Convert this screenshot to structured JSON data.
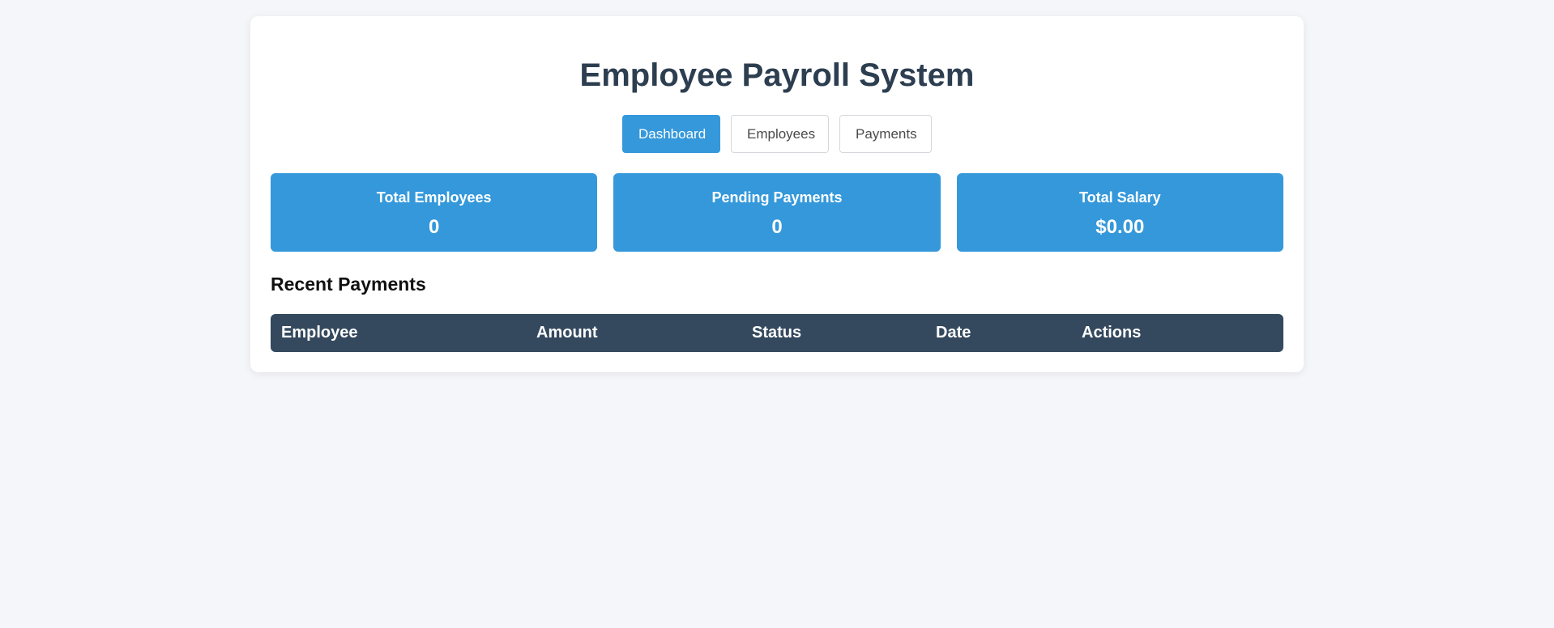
{
  "header": {
    "title": "Employee Payroll System"
  },
  "nav": {
    "items": [
      {
        "label": "Dashboard",
        "active": true
      },
      {
        "label": "Employees",
        "active": false
      },
      {
        "label": "Payments",
        "active": false
      }
    ]
  },
  "stats": [
    {
      "label": "Total Employees",
      "value": "0"
    },
    {
      "label": "Pending Payments",
      "value": "0"
    },
    {
      "label": "Total Salary",
      "value": "$0.00"
    }
  ],
  "recent_payments": {
    "title": "Recent Payments",
    "columns": [
      "Employee",
      "Amount",
      "Status",
      "Date",
      "Actions"
    ],
    "rows": []
  },
  "colors": {
    "accent": "#3498db",
    "table_header": "#34495e",
    "title": "#2c3e50",
    "background": "#f5f6fa"
  }
}
